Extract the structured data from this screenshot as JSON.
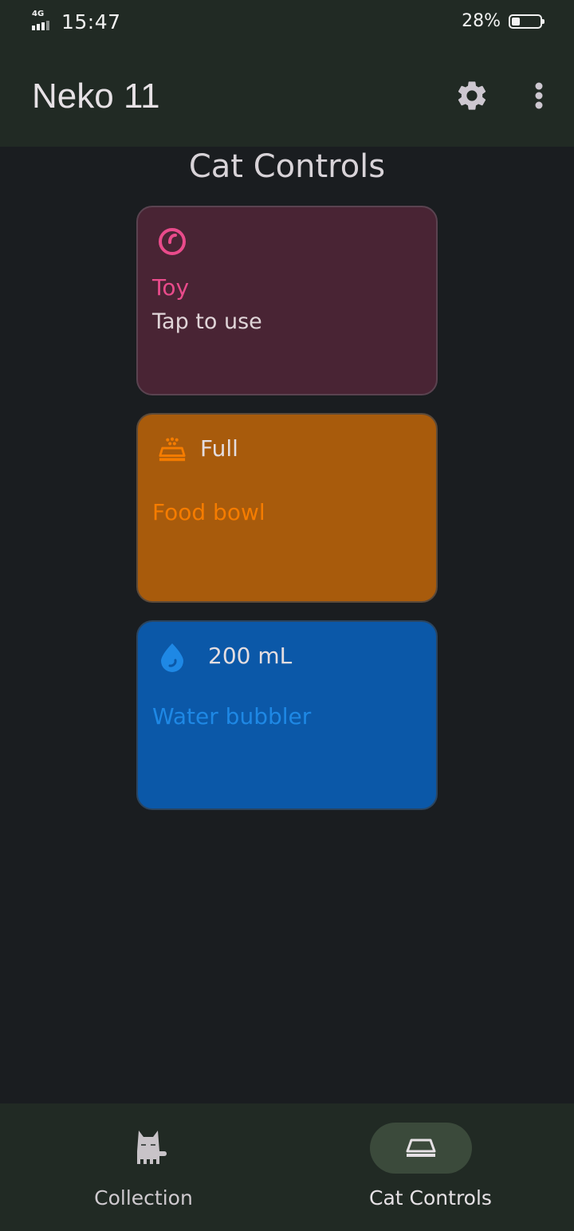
{
  "status_bar": {
    "network": "4G",
    "time": "15:47",
    "battery": "28%",
    "battery_level": 0.28
  },
  "app_bar": {
    "title": "Neko 11",
    "settings_icon": "gear-icon",
    "more_icon": "more-vert-icon"
  },
  "section": {
    "title": "Cat Controls"
  },
  "controls": {
    "toy": {
      "name": "Toy",
      "subtitle": "Tap to use",
      "icon": "toy-ball-icon",
      "color": "#e94b8b"
    },
    "food": {
      "status": "Full",
      "name": "Food bowl",
      "icon": "food-bowl-icon",
      "color": "#f57c00"
    },
    "water": {
      "status": "200 mL",
      "name": "Water bubbler",
      "icon": "water-drop-icon",
      "color": "#1e88e5"
    }
  },
  "bottom_nav": {
    "items": [
      {
        "label": "Collection",
        "icon": "cat-icon",
        "selected": false
      },
      {
        "label": "Cat Controls",
        "icon": "bowl-icon",
        "selected": true
      }
    ]
  }
}
